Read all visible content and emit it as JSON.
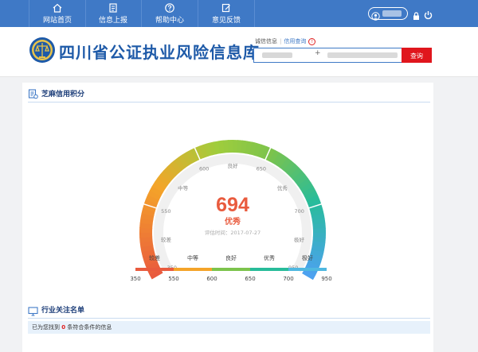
{
  "nav": {
    "items": [
      {
        "label": "网站首页",
        "icon": "home-icon"
      },
      {
        "label": "信息上报",
        "icon": "upload-report-icon"
      },
      {
        "label": "帮助中心",
        "icon": "help-icon"
      },
      {
        "label": "意见反馈",
        "icon": "feedback-icon"
      }
    ]
  },
  "header": {
    "title": "四川省公证执业风险信息库",
    "search_tabs": [
      "诚信信息",
      "信用查询"
    ],
    "search_button": "查询",
    "search_plus": "+"
  },
  "credit": {
    "section_title": "芝麻信用积分",
    "score": "694",
    "grade": "优秀",
    "eval_time": "评估时间：2017-07-27",
    "arc_labels": [
      "较差",
      "中等",
      "良好",
      "优秀",
      "极好"
    ],
    "arc_ticks": [
      "350",
      "550",
      "600",
      "650",
      "700",
      "950"
    ],
    "legend_labels": [
      "较差",
      "中等",
      "良好",
      "优秀",
      "极好"
    ],
    "legend_ticks": [
      "350",
      "550",
      "600",
      "650",
      "700",
      "950"
    ],
    "legend_colors": [
      "#e95b3e",
      "#f4a429",
      "#7cc34c",
      "#28bc9a",
      "#4fb8e0"
    ],
    "min": 350,
    "max": 950
  },
  "watchlist": {
    "section_title": "行业关注名单",
    "result_prefix": "已为您找到",
    "result_count": "0",
    "result_suffix": "条符合条件的信息"
  }
}
